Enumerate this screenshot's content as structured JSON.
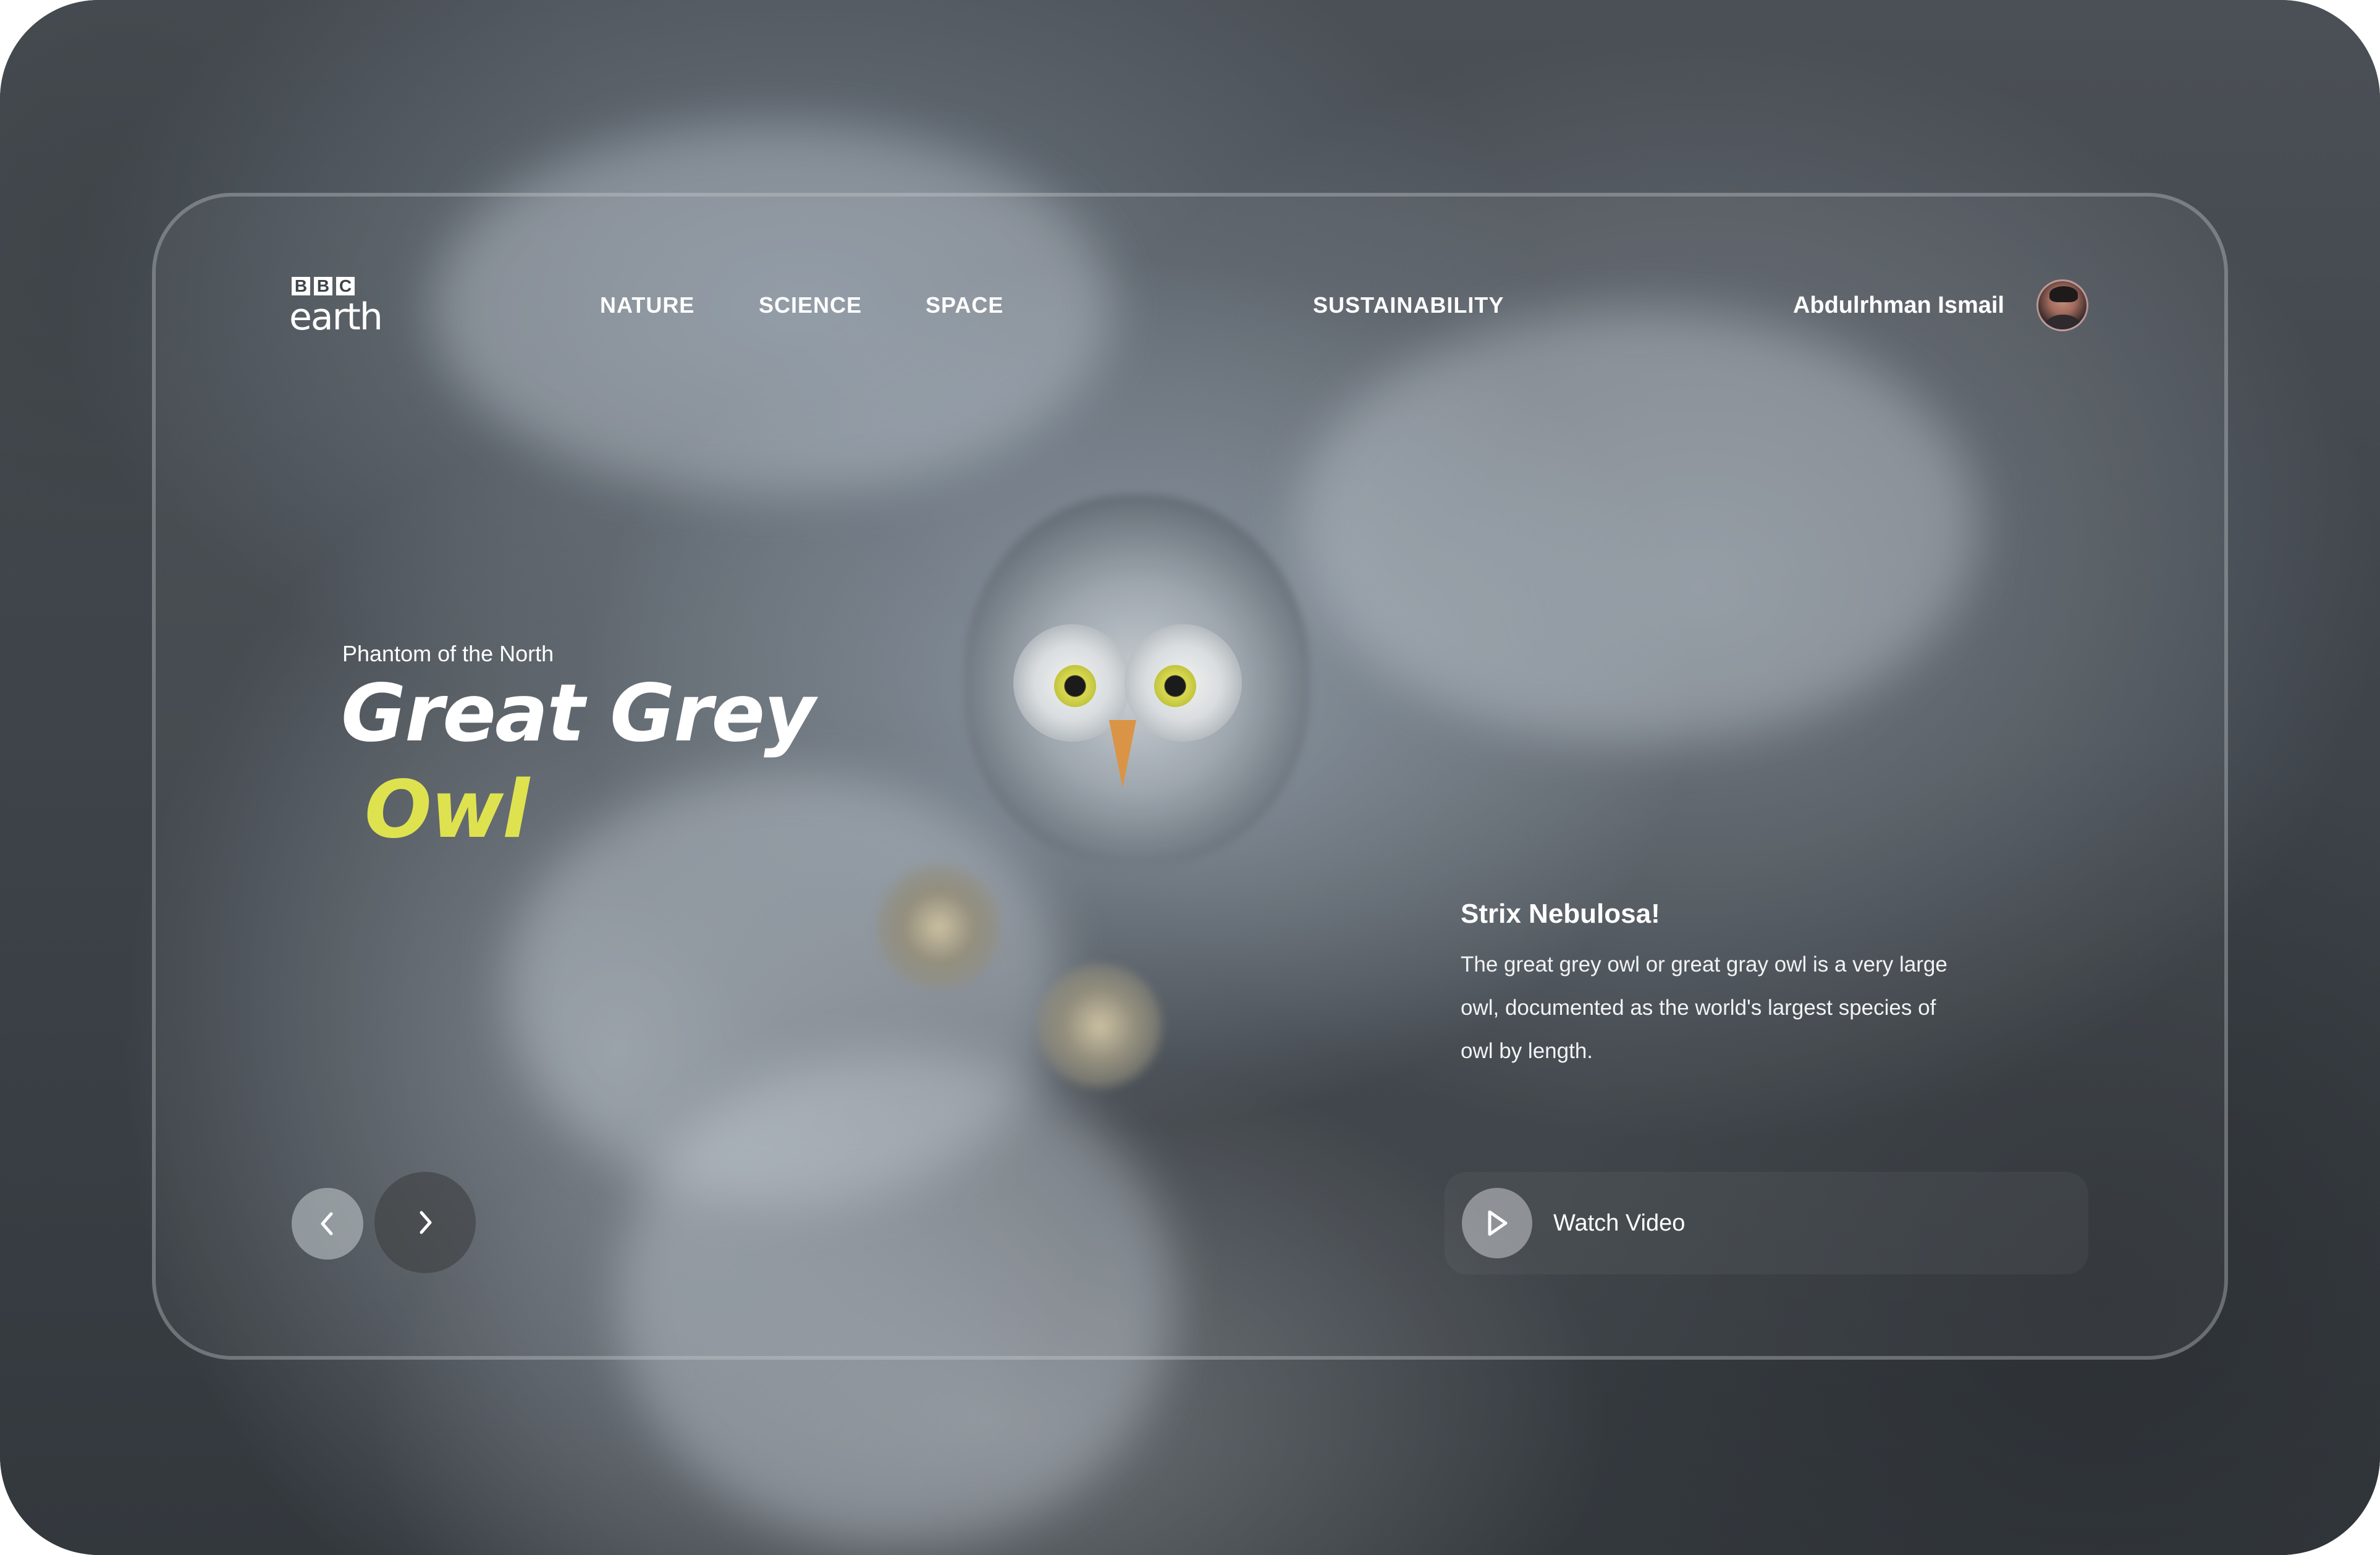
{
  "brand": {
    "logo_letters": [
      "B",
      "B",
      "C"
    ],
    "logo_word": "earth"
  },
  "nav": {
    "items": [
      {
        "label": "NATURE"
      },
      {
        "label": "SCIENCE"
      },
      {
        "label": "SPACE"
      },
      {
        "label": "SUSTAINABILITY"
      }
    ]
  },
  "user": {
    "name": "Abdulrhman Ismail"
  },
  "hero": {
    "eyebrow": "Phantom of the North",
    "title_line1": "Great Grey",
    "title_line2": "Owl",
    "accent_color": "#dfe24f"
  },
  "description": {
    "title": "Strix Nebulosa!",
    "body": "The great grey owl or great gray owl is a very large owl, documented as the world's largest species of owl by length."
  },
  "actions": {
    "watch_video_label": "Watch Video"
  },
  "icons": {
    "prev": "chevron-left-icon",
    "next": "chevron-right-icon",
    "play": "play-icon"
  }
}
